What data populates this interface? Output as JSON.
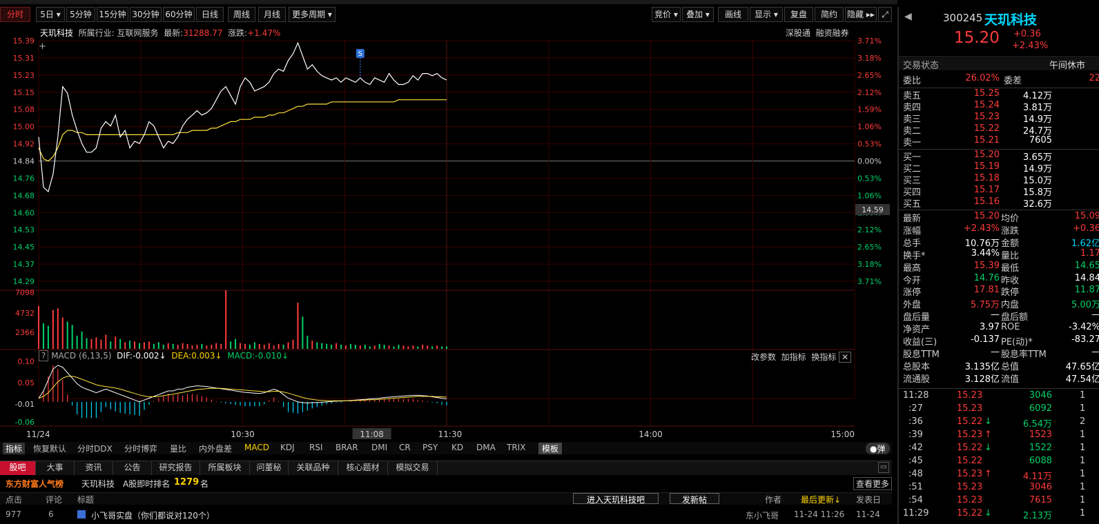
{
  "period_tabs": [
    "分时",
    "5日",
    "5分钟",
    "15分钟",
    "30分钟",
    "60分钟",
    "日线",
    "周线",
    "月线",
    "更多周期"
  ],
  "right_tools": [
    "竞价",
    "叠加",
    "画线",
    "显示",
    "复盘",
    "简约",
    "隐藏"
  ],
  "info": {
    "stock_name": "天玑科技",
    "industry_label": "所属行业:",
    "industry": "互联网服务",
    "latest_label": "最新:",
    "latest": "31288.77",
    "change_label": "涨跌:",
    "change": "+1.47%"
  },
  "top_links": [
    "深股通",
    "融资融券"
  ],
  "chart_data": {
    "type": "line",
    "price_ticks": [
      "15.39",
      "15.31",
      "15.23",
      "15.15",
      "15.08",
      "15.00",
      "14.92",
      "14.84",
      "14.76",
      "14.68",
      "14.60",
      "14.53",
      "14.45",
      "14.37",
      "14.29"
    ],
    "pct_ticks": [
      "3.71%",
      "3.18%",
      "2.65%",
      "2.12%",
      "1.59%",
      "1.06%",
      "0.53%",
      "0.00%",
      "0.53%",
      "1.06%",
      "1.59%",
      "2.12%",
      "2.65%",
      "3.18%",
      "3.71%"
    ],
    "prev_close": 14.84,
    "ylim": [
      14.29,
      15.39
    ],
    "volume_ticks": [
      "7098",
      "4732",
      "2366"
    ],
    "macd_ticks": [
      "0.10",
      "0.05",
      "-0.01",
      "-0.06"
    ],
    "time_labels": [
      "11/24",
      "10:30",
      "11:08",
      "11:30",
      "14:00",
      "15:00"
    ],
    "cursor_price": "14.59",
    "marker": "S",
    "price": [
      14.95,
      14.72,
      14.7,
      14.78,
      14.95,
      15.18,
      15.15,
      15.05,
      14.98,
      14.92,
      14.88,
      14.88,
      14.9,
      14.99,
      15.02,
      15.0,
      15.05,
      14.95,
      14.98,
      14.9,
      14.93,
      14.92,
      14.96,
      15.02,
      15.0,
      14.95,
      14.9,
      14.93,
      14.92,
      14.95,
      15.0,
      15.03,
      15.05,
      15.07,
      15.05,
      15.06,
      15.08,
      15.12,
      15.16,
      15.18,
      15.14,
      15.1,
      15.18,
      15.22,
      15.2,
      15.16,
      15.17,
      15.18,
      15.2,
      15.24,
      15.26,
      15.25,
      15.3,
      15.33,
      15.38,
      15.32,
      15.26,
      15.28,
      15.25,
      15.23,
      15.22,
      15.21,
      15.22,
      15.2,
      15.22,
      15.21,
      15.2,
      15.22,
      15.2,
      15.19,
      15.22,
      15.21,
      15.2,
      15.24,
      15.21,
      15.19,
      15.19,
      15.2,
      15.23,
      15.21,
      15.24,
      15.24,
      15.23,
      15.24,
      15.22,
      15.21
    ],
    "avg": [
      14.9,
      14.85,
      14.84,
      14.86,
      14.9,
      14.96,
      14.98,
      14.98,
      14.97,
      14.97,
      14.96,
      14.96,
      14.96,
      14.96,
      14.96,
      14.96,
      14.96,
      14.96,
      14.96,
      14.96,
      14.96,
      14.96,
      14.96,
      14.96,
      14.96,
      14.96,
      14.96,
      14.96,
      14.96,
      14.97,
      14.97,
      14.97,
      14.98,
      14.98,
      14.98,
      14.98,
      14.99,
      14.99,
      15.0,
      15.01,
      15.02,
      15.02,
      15.03,
      15.03,
      15.03,
      15.04,
      15.04,
      15.04,
      15.05,
      15.05,
      15.06,
      15.06,
      15.07,
      15.08,
      15.09,
      15.09,
      15.1,
      15.1,
      15.1,
      15.1,
      15.1,
      15.11,
      15.11,
      15.11,
      15.11,
      15.11,
      15.11,
      15.11,
      15.11,
      15.11,
      15.11,
      15.11,
      15.11,
      15.11,
      15.11,
      15.12,
      15.12,
      15.12,
      15.12,
      15.12,
      15.12,
      15.12,
      15.12,
      15.12,
      15.12,
      15.12
    ],
    "volume": [
      5200,
      3100,
      2800,
      4700,
      4900,
      3800,
      3300,
      2900,
      1600,
      2100,
      1300,
      1200,
      1400,
      1100,
      1700,
      900,
      1500,
      1200,
      800,
      1000,
      900,
      700,
      800,
      900,
      600,
      800,
      500,
      700,
      600,
      500,
      700,
      600,
      400,
      500,
      600,
      400,
      500,
      700,
      600,
      7098,
      900,
      1200,
      700,
      600,
      500,
      800,
      600,
      500,
      700,
      400,
      600,
      500,
      800,
      1100,
      5600,
      3900,
      1600,
      1000,
      800,
      700,
      600,
      500,
      700,
      500,
      400,
      600,
      500,
      400,
      500,
      300,
      400,
      600,
      500,
      400,
      300,
      500,
      400,
      300,
      400,
      300,
      500,
      400,
      300,
      400,
      300,
      300
    ],
    "macd_dif": [
      0.0,
      0.02,
      0.05,
      0.08,
      0.09,
      0.085,
      0.07,
      0.055,
      0.04,
      0.03,
      0.025,
      0.02,
      0.015,
      0.02,
      0.025,
      0.02,
      0.015,
      0.01,
      0.005,
      0.0,
      -0.005,
      -0.01,
      -0.005,
      0.0,
      0.005,
      0.01,
      0.015,
      0.02,
      0.02,
      0.025,
      0.025,
      0.03,
      0.032,
      0.034,
      0.033,
      0.032,
      0.03,
      0.028,
      0.026,
      0.024,
      0.022,
      0.02,
      0.018,
      0.016,
      0.015,
      0.014,
      0.013,
      0.015,
      0.02,
      0.025,
      0.02,
      0.01,
      0.0,
      -0.005,
      -0.01,
      -0.012,
      -0.013,
      -0.012,
      -0.012,
      -0.011,
      -0.01,
      -0.009,
      -0.008,
      -0.008,
      -0.007,
      -0.006,
      -0.005,
      -0.004,
      -0.003,
      -0.002,
      -0.001,
      0.0,
      0.002,
      0.003,
      0.004,
      0.005,
      0.006,
      0.007,
      0.008,
      0.008,
      0.007,
      0.006,
      0.004,
      0.002,
      0.0,
      -0.002
    ],
    "macd_dea": [
      0.0,
      0.005,
      0.015,
      0.03,
      0.045,
      0.055,
      0.06,
      0.06,
      0.057,
      0.052,
      0.047,
      0.042,
      0.037,
      0.034,
      0.032,
      0.03,
      0.028,
      0.025,
      0.021,
      0.017,
      0.013,
      0.009,
      0.006,
      0.004,
      0.004,
      0.005,
      0.007,
      0.009,
      0.011,
      0.014,
      0.016,
      0.019,
      0.021,
      0.024,
      0.025,
      0.026,
      0.027,
      0.027,
      0.027,
      0.026,
      0.025,
      0.024,
      0.023,
      0.022,
      0.021,
      0.02,
      0.019,
      0.018,
      0.018,
      0.019,
      0.019,
      0.017,
      0.014,
      0.01,
      0.006,
      0.002,
      -0.001,
      -0.003,
      -0.005,
      -0.006,
      -0.007,
      -0.007,
      -0.007,
      -0.007,
      -0.007,
      -0.007,
      -0.006,
      -0.006,
      -0.005,
      -0.004,
      -0.004,
      -0.003,
      -0.002,
      -0.001,
      0.0,
      0.001,
      0.002,
      0.003,
      0.004,
      0.005,
      0.005,
      0.005,
      0.005,
      0.004,
      0.004,
      0.003
    ]
  },
  "macd_header": {
    "help": "?",
    "title": "MACD (6,13,5)",
    "dif": "DIF:-0.002↓",
    "dea": "DEA:0.003↓",
    "macd": "MACD:-0.010↓"
  },
  "macd_tools": [
    "改参数",
    "加指标",
    "换指标"
  ],
  "indicators": [
    "指标",
    "恢复默认",
    "分时DDX",
    "分时博弈",
    "量比",
    "内外盘差",
    "MACD",
    "KDJ",
    "RSI",
    "BRAR",
    "DMI",
    "CR",
    "PSY",
    "KD",
    "DMA",
    "TRIX",
    "模板"
  ],
  "popup_toggle": "弹",
  "bottom_tabs": [
    "股吧",
    "大事",
    "资讯",
    "公告",
    "研究报告",
    "所属板块",
    "问董秘",
    "关联品种",
    "核心题材",
    "模拟交易"
  ],
  "rank": {
    "board": "东方财富人气榜",
    "stock": "天玑科技",
    "label": "A股即时排名",
    "value": "1279",
    "unit": "名",
    "more": "查看更多"
  },
  "table_head": {
    "cols": [
      "点击",
      "评论",
      "标题"
    ],
    "enter_btn": "进入天玑科技吧",
    "post_btn": "发新帖",
    "author": "作者",
    "latest_update": "最后更新↓",
    "post_date": "发表日"
  },
  "post_row": {
    "clicks": "977",
    "comments": "6",
    "title": "小飞哥实盘（你们都说对120个）",
    "author": "东小飞哥",
    "updated": "11-24 11:26",
    "date": "11-24"
  },
  "right_panel": {
    "code": "300245",
    "name": "天玑科技",
    "price": "15.20",
    "change": "+0.36",
    "change_pct": "+2.43%",
    "status_label": "交易状态",
    "status": "午间休市",
    "weibi_label": "委比",
    "weibi": "26.02%",
    "weicha_label": "委差",
    "weicha": "22",
    "asks": [
      {
        "label": "卖五",
        "price": "15.25",
        "vol": "4.12万"
      },
      {
        "label": "卖四",
        "price": "15.24",
        "vol": "3.81万"
      },
      {
        "label": "卖三",
        "price": "15.23",
        "vol": "14.9万"
      },
      {
        "label": "卖二",
        "price": "15.22",
        "vol": "24.7万"
      },
      {
        "label": "卖一",
        "price": "15.21",
        "vol": "7605"
      }
    ],
    "bids": [
      {
        "label": "买一",
        "price": "15.20",
        "vol": "3.65万"
      },
      {
        "label": "买二",
        "price": "15.19",
        "vol": "14.9万"
      },
      {
        "label": "买三",
        "price": "15.18",
        "vol": "15.0万"
      },
      {
        "label": "买四",
        "price": "15.17",
        "vol": "15.8万"
      },
      {
        "label": "买五",
        "price": "15.16",
        "vol": "32.6万"
      }
    ],
    "stats": [
      {
        "l1": "最新",
        "v1": "15.20",
        "c1": "red",
        "l2": "均价",
        "v2": "15.09",
        "c2": "red"
      },
      {
        "l1": "涨幅",
        "v1": "+2.43%",
        "c1": "red",
        "l2": "涨跌",
        "v2": "+0.36",
        "c2": "red"
      },
      {
        "l1": "总手",
        "v1": "10.76万",
        "c1": "white",
        "l2": "金额",
        "v2": "1.62亿",
        "c2": "cyan"
      },
      {
        "l1": "换手*",
        "v1": "3.44%",
        "c1": "white",
        "l2": "量比",
        "v2": "1.17",
        "c2": "red"
      },
      {
        "l1": "最高",
        "v1": "15.39",
        "c1": "red",
        "l2": "最低",
        "v2": "14.65",
        "c2": "green"
      },
      {
        "l1": "今开",
        "v1": "14.76",
        "c1": "green",
        "l2": "昨收",
        "v2": "14.84",
        "c2": "white"
      },
      {
        "l1": "涨停",
        "v1": "17.81",
        "c1": "red",
        "l2": "跌停",
        "v2": "11.87",
        "c2": "green"
      },
      {
        "l1": "外盘",
        "v1": "5.75万",
        "c1": "red",
        "l2": "内盘",
        "v2": "5.00万",
        "c2": "green"
      },
      {
        "l1": "盘后量",
        "v1": "—",
        "c1": "white",
        "l2": "盘后额",
        "v2": "—",
        "c2": "white"
      },
      {
        "l1": "净资产",
        "v1": "3.97",
        "c1": "white",
        "l2": "ROE",
        "v2": "-3.42%",
        "c2": "white"
      },
      {
        "l1": "收益(三)",
        "v1": "-0.137",
        "c1": "white",
        "l2": "PE(动)*",
        "v2": "-83.27",
        "c2": "white"
      },
      {
        "l1": "股息TTM",
        "v1": "—",
        "c1": "white",
        "l2": "股息率TTM",
        "v2": "—",
        "c2": "white"
      },
      {
        "l1": "总股本",
        "v1": "3.135亿",
        "c1": "white",
        "l2": "总值",
        "v2": "47.65亿",
        "c2": "white"
      },
      {
        "l1": "流通股",
        "v1": "3.128亿",
        "c1": "white",
        "l2": "流值",
        "v2": "47.54亿",
        "c2": "white"
      }
    ],
    "ticks": [
      {
        "time": "11:28",
        "price": "15.23",
        "arrow": "",
        "pc": "red",
        "vol": "3046",
        "vc": "green",
        "n": "1"
      },
      {
        "time": ":27",
        "price": "15.23",
        "arrow": "",
        "pc": "red",
        "vol": "6092",
        "vc": "green",
        "n": "1"
      },
      {
        "time": ":36",
        "price": "15.22",
        "arrow": "↓",
        "pc": "red",
        "vol": "6.54万",
        "vc": "green",
        "n": "2"
      },
      {
        "time": ":39",
        "price": "15.23",
        "arrow": "↑",
        "pc": "red",
        "vol": "1523",
        "vc": "red",
        "n": "1"
      },
      {
        "time": ":42",
        "price": "15.22",
        "arrow": "↓",
        "pc": "red",
        "vol": "1522",
        "vc": "green",
        "n": "1"
      },
      {
        "time": ":45",
        "price": "15.22",
        "arrow": "",
        "pc": "red",
        "vol": "6088",
        "vc": "green",
        "n": "1"
      },
      {
        "time": ":48",
        "price": "15.23",
        "arrow": "↑",
        "pc": "red",
        "vol": "4.11万",
        "vc": "red",
        "n": "1"
      },
      {
        "time": ":51",
        "price": "15.23",
        "arrow": "",
        "pc": "red",
        "vol": "3046",
        "vc": "red",
        "n": "1"
      },
      {
        "time": ":54",
        "price": "15.23",
        "arrow": "",
        "pc": "red",
        "vol": "7615",
        "vc": "red",
        "n": "1"
      },
      {
        "time": "11:29",
        "price": "15.22",
        "arrow": "↓",
        "pc": "red",
        "vol": "2.13万",
        "vc": "green",
        "n": "1"
      }
    ]
  },
  "colors": {
    "red": "#ff3b3b",
    "green": "#00d26a",
    "price_line": "#ffffff",
    "avg_line": "#ffe23c",
    "grid": "#3a0000"
  }
}
